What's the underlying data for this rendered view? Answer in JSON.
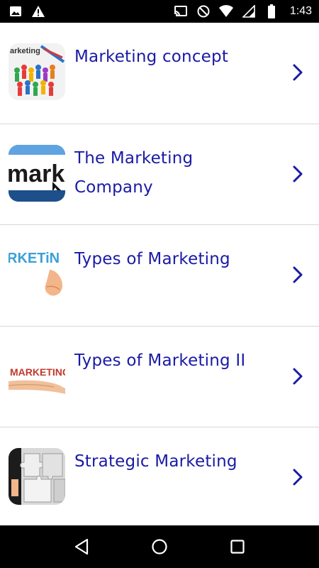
{
  "status_bar": {
    "time": "1:43",
    "left_icons": [
      "image-icon",
      "warning-icon"
    ],
    "right_icons": [
      "cast-icon",
      "do-not-disturb-icon",
      "wifi-icon",
      "signal-icon",
      "battery-icon"
    ]
  },
  "list": {
    "items": [
      {
        "label": "Marketing concept",
        "thumbnail": "marketing-people-thumbnail"
      },
      {
        "label": "The Marketing Company",
        "thumbnail": "marketing-keyboard-thumbnail"
      },
      {
        "label": "Types of Marketing",
        "thumbnail": "marketing-hand-thumbnail"
      },
      {
        "label": "Types of Marketing II",
        "thumbnail": "marketing-letters-thumbnail"
      },
      {
        "label": "Strategic Marketing",
        "thumbnail": "puzzle-thumbnail"
      }
    ],
    "thumbnail_text": {
      "item0": "arketing",
      "item1": "mark",
      "item2": "RKETiN",
      "item3": "MARKETING"
    }
  },
  "colors": {
    "title": "#1a1aa6",
    "chevron": "#1a1aa6",
    "divider": "#d6d6d6",
    "system_bars": "#000000"
  },
  "nav_bar": {
    "buttons": [
      "back-icon",
      "home-icon",
      "recents-icon"
    ]
  }
}
